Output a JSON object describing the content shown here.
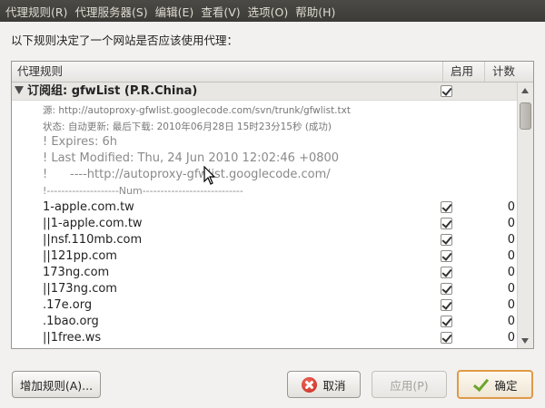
{
  "menubar": {
    "items": [
      "代理规则(R)",
      "代理服务器(S)",
      "编辑(E)",
      "查看(V)",
      "选项(O)",
      "帮助(H)"
    ]
  },
  "intro_text": "以下规则决定了一个网站是否应该使用代理：",
  "table": {
    "columns": {
      "rule": "代理规则",
      "enabled": "启用",
      "count": "计数"
    },
    "group": {
      "title": "订阅组: gfwList (P.R.China)",
      "enabled": true,
      "source_line": "源:  http://autoproxy-gfwlist.googlecode.com/svn/trunk/gfwlist.txt",
      "status_line": "状态:  自动更新; 最后下载: 2010年06月28日 15时23分15秒 (成功)"
    },
    "comments": [
      "! Expires: 6h",
      "! Last Modified: Thu, 24 Jun 2010 12:02:46 +0800",
      "!      ----http://autoproxy-gfwlist.googlecode.com/",
      "!--------------------Num----------------------------"
    ],
    "rules": [
      {
        "text": "1-apple.com.tw",
        "enabled": true,
        "count": "0"
      },
      {
        "text": "||1-apple.com.tw",
        "enabled": true,
        "count": "0"
      },
      {
        "text": "||nsf.110mb.com",
        "enabled": true,
        "count": "0"
      },
      {
        "text": "||121pp.com",
        "enabled": true,
        "count": "0"
      },
      {
        "text": "173ng.com",
        "enabled": true,
        "count": "0"
      },
      {
        "text": "||173ng.com",
        "enabled": true,
        "count": "0"
      },
      {
        "text": ".17e.org",
        "enabled": true,
        "count": "0"
      },
      {
        "text": ".1bao.org",
        "enabled": true,
        "count": "0"
      },
      {
        "text": "||1free.ws",
        "enabled": true,
        "count": "0"
      }
    ]
  },
  "buttons": {
    "add_rule": "增加规则(A)...",
    "cancel": "取消",
    "apply": "应用(P)",
    "ok": "确定"
  },
  "colors": {
    "menubar": "#3c3b37",
    "default_button_border": "#e09a47",
    "cancel_icon": "#c8261b",
    "ok_icon": "#6aa52b"
  }
}
